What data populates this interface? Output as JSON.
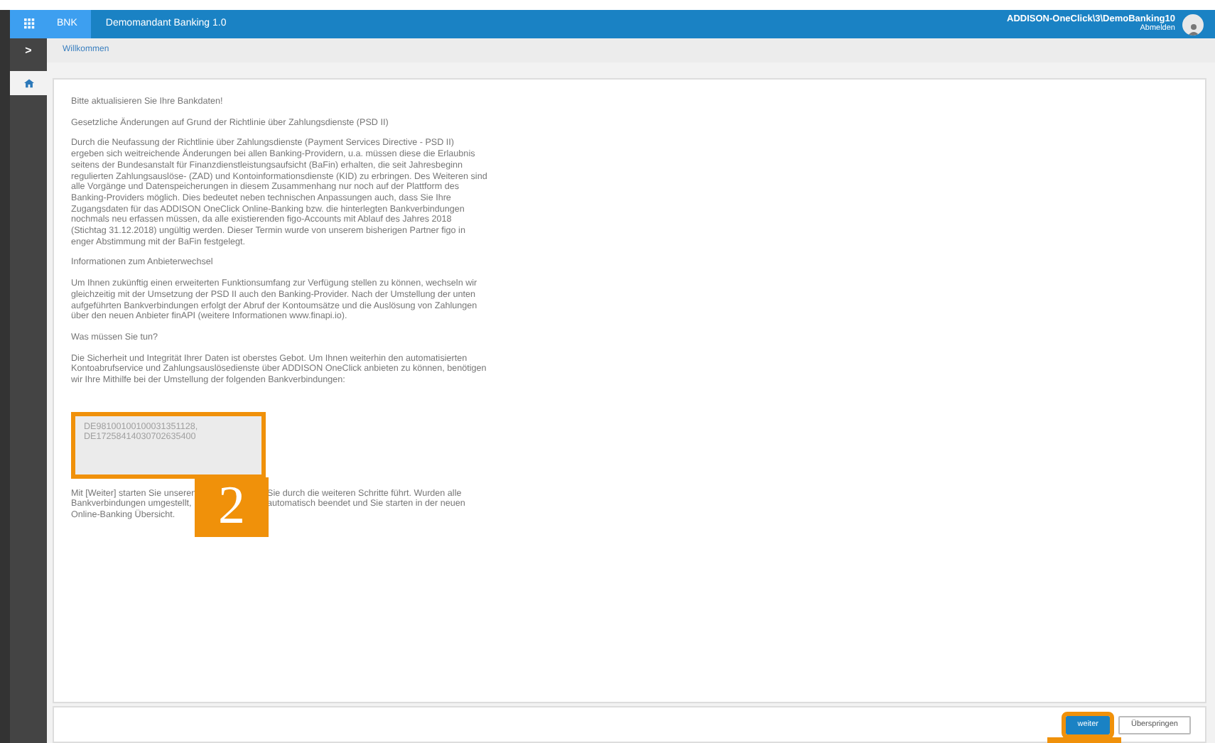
{
  "header": {
    "app_code": "BNK",
    "title": "Demomandant Banking 1.0",
    "user": "ADDISON-OneClick\\3\\DemoBanking10",
    "logout": "Abmelden"
  },
  "sidebar_toggle": ">",
  "breadcrumb": "Willkommen",
  "content": {
    "paragraphs": [
      "Bitte aktualisieren Sie Ihre Bankdaten!",
      "Gesetzliche Änderungen auf Grund der Richtlinie über Zahlungsdienste (PSD II)",
      "Durch die Neufassung der Richtlinie über Zahlungsdienste (Payment Services Directive - PSD II) ergeben sich weitreichende Änderungen bei allen Banking-Providern, u.a. müssen diese die Erlaubnis seitens der Bundesanstalt für Finanzdienstleistungsaufsicht (BaFin) erhalten, die seit Jahresbeginn regulierten Zahlungsauslöse- (ZAD) und Kontoinformationsdienste (KID) zu erbringen. Des Weiteren sind alle Vorgänge und Datenspeicherungen in diesem Zusammenhang nur noch auf der Plattform des Banking-Providers möglich. Dies bedeutet neben technischen Anpassungen auch, dass Sie Ihre Zugangsdaten für das ADDISON OneClick Online-Banking bzw. die hinterlegten Bankverbindungen nochmals neu erfassen müssen, da alle existierenden figo-Accounts mit Ablauf des Jahres 2018 (Stichtag 31.12.2018) ungültig werden. Dieser Termin wurde von unserem bisherigen Partner figo in enger Abstimmung mit der BaFin festgelegt.",
      "Informationen zum Anbieterwechsel",
      "Um Ihnen zukünftig einen erweiterten Funktionsumfang zur Verfügung stellen zu können, wechseln wir gleichzeitig mit der Umsetzung der PSD II auch den Banking-Provider. Nach der Umstellung der unten aufgeführten Bankverbindungen erfolgt der Abruf der Kontoumsätze und die Auslösung von Zahlungen über den neuen Anbieter finAPI (weitere Informationen www.finapi.io).",
      "Was müssen Sie tun?",
      "Die Sicherheit und Integrität Ihrer Daten ist oberstes Gebot. Um Ihnen weiterhin den automatisierten Kontoabrufservice und Zahlungsauslösedienste über ADDISON OneClick anbieten zu können, benötigen wir Ihre Mithilfe bei der Umstellung der folgenden Bankverbindungen:"
    ],
    "accounts_field": {
      "value": "DE98100100100031351128,\nDE17258414030702635400",
      "disabled": true,
      "highlighted": true
    },
    "partly_covered_lines": [
      {
        "left": "Mit [Weiter] starten Sie unseren",
        "right": "Sie durch die weiteren Schritte führt. Wurden alle"
      },
      {
        "left": "Bankverbindungen umgestellt,",
        "right": "automatisch beendet und Sie starten in der neuen"
      },
      {
        "left": "Online-Banking Übersicht."
      }
    ]
  },
  "annotation": {
    "number": "2"
  },
  "footer": {
    "buttons": [
      {
        "label": "weiter",
        "kind": "primary",
        "highlighted": true
      },
      {
        "label": "Überspringen",
        "kind": "secondary",
        "highlighted": false
      }
    ]
  }
}
